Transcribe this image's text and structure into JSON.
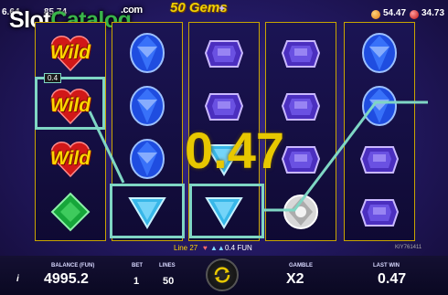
{
  "top_left": {
    "left_value": "6.64",
    "right_value": "85.74"
  },
  "watermark": {
    "slot": "Slot",
    "catalog": "Catalog",
    "com": ".com"
  },
  "game_title": "50 Gems",
  "top_right": {
    "value_1": "54.47",
    "value_2": "34.73"
  },
  "reels": [
    [
      "Wild",
      "Wild",
      "Wild",
      "emerald"
    ],
    [
      "sapphire",
      "sapphire",
      "sapphire",
      "aquamarine"
    ],
    [
      "amethyst",
      "amethyst",
      "aquamarine",
      "aquamarine"
    ],
    [
      "amethyst",
      "amethyst",
      "amethyst",
      "diamond"
    ],
    [
      "sapphire",
      "sapphire",
      "amethyst",
      "amethyst"
    ]
  ],
  "line_win_badge": "0.4",
  "win_display": "0.47",
  "win_line": {
    "text": "Line 27",
    "amount": "0.4 FUN"
  },
  "game_id": "KIY761411",
  "bottom_bar": {
    "balance_label": "BALANCE (FUN)",
    "balance_value": "4995.2",
    "bet_label": "BET",
    "bet_value": "1",
    "lines_label": "LINES",
    "lines_value": "50",
    "gamble_label": "GAMBLE",
    "gamble_value": "X2",
    "last_win_label": "LAST WIN",
    "last_win_value": "0.47"
  },
  "colors": {
    "reel_border": "#c9a500",
    "win_line": "#7fd6c4",
    "win_text": "#e8c800",
    "brand_green": "#39b54a"
  }
}
